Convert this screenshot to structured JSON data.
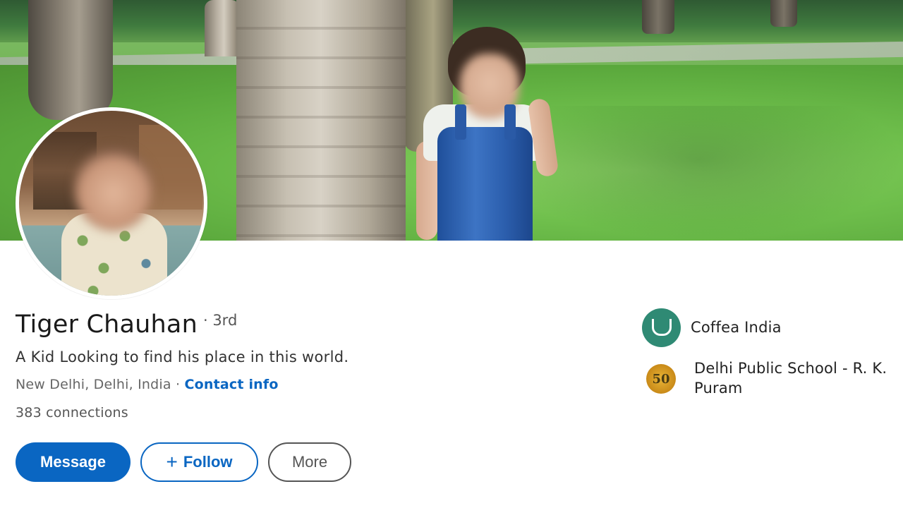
{
  "profile": {
    "name": "Tiger Chauhan",
    "degree": "· 3rd",
    "headline": "A Kid Looking to find his place in this world.",
    "location": "New Delhi, Delhi, India",
    "separator": "·",
    "contact_label": "Contact info",
    "connections": "383 connections"
  },
  "actions": {
    "message_label": "Message",
    "follow_plus": "+",
    "follow_label": "Follow",
    "more_label": "More"
  },
  "orgs": [
    {
      "name": "Coffea India",
      "logo": "coffea-logo"
    },
    {
      "name": "Delhi Public School - R. K. Puram",
      "logo": "dps-logo",
      "logo_text": "50"
    }
  ],
  "colors": {
    "accent": "#0a66c2",
    "text": "#1a1a1a",
    "muted": "#666666"
  }
}
